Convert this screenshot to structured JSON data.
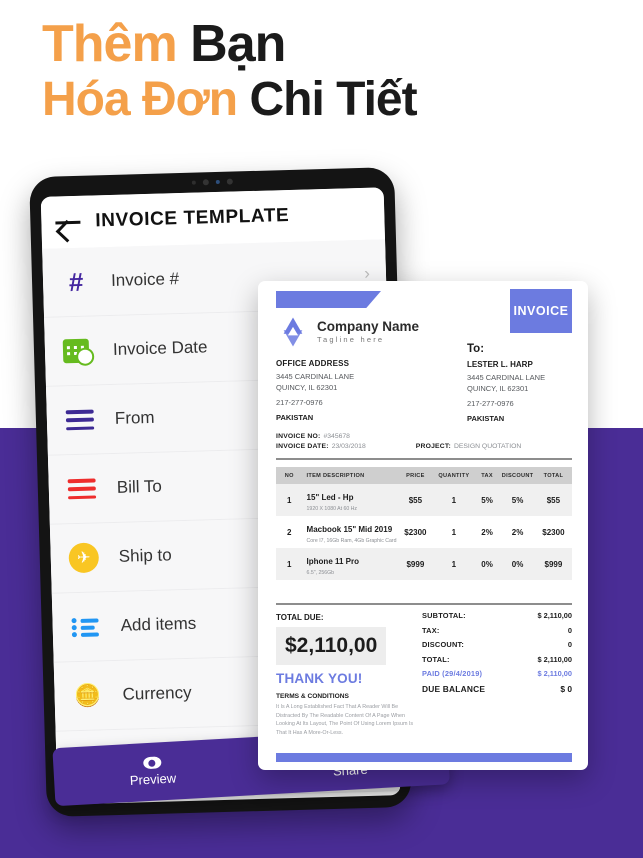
{
  "headline": {
    "line1_accent": "Thêm",
    "line1_rest": " Bạn",
    "line2_accent": "Hóa Đơn",
    "line2_rest": " Chi Tiết"
  },
  "colors": {
    "accent_orange": "#f4a04a",
    "background_purple": "#4a2d96",
    "invoice_blue": "#6c7be0",
    "tablet_black": "#141414"
  },
  "app": {
    "title": "INVOICE TEMPLATE",
    "back_icon": "back-arrow-icon",
    "menu": [
      {
        "label": "Invoice #",
        "icon": "hash-icon",
        "chevron": "›"
      },
      {
        "label": "Invoice Date",
        "icon": "calendar-clock-icon",
        "chevron": ""
      },
      {
        "label": "From",
        "icon": "purple-lines-icon",
        "chevron": ""
      },
      {
        "label": "Bill To",
        "icon": "red-lines-icon",
        "chevron": ""
      },
      {
        "label": "Ship to",
        "icon": "airplane-icon",
        "chevron": ""
      },
      {
        "label": "Add items",
        "icon": "bullet-list-icon",
        "chevron": ""
      },
      {
        "label": "Currency",
        "icon": "coins-icon",
        "chevron": ""
      }
    ],
    "actions": [
      {
        "label": "Preview",
        "icon": "eye-icon"
      },
      {
        "label": "Share",
        "icon": "send-icon"
      }
    ]
  },
  "invoice": {
    "badge": "INVOICE",
    "company_name": "Company Name",
    "tagline": "Tagline here",
    "logo_icon": "star-logo-icon",
    "office": {
      "heading": "OFFICE ADDRESS",
      "line1": "3445 CARDINAL LANE",
      "line2": "QUINCY, IL 62301",
      "phone": "217-277-0976",
      "country": "PAKISTAN"
    },
    "to": {
      "heading": "To:",
      "name": "LESTER L. HARP",
      "line1": "3445 CARDINAL LANE",
      "line2": "QUINCY, IL 62301",
      "phone": "217-277-0976",
      "country": "PAKISTAN"
    },
    "meta": {
      "invoice_no_label": "INVOICE NO:",
      "invoice_no_value": "#345678",
      "invoice_date_label": "INVOICE DATE:",
      "invoice_date_value": "23/03/2018",
      "project_label": "PROJECT:",
      "project_value": "DESIGN QUOTATION"
    },
    "table": {
      "headers": [
        "NO",
        "ITEM DESCRIPTION",
        "PRICE",
        "QUANTITY",
        "TAX",
        "DISCOUNT",
        "TOTAL"
      ],
      "rows": [
        {
          "no": "1",
          "name": "15\" Led - Hp",
          "sub": "1920 X 1080 At 60 Hz",
          "price": "$55",
          "qty": "1",
          "tax": "5%",
          "discount": "5%",
          "total": "$55"
        },
        {
          "no": "2",
          "name": "Macbook 15\" Mid 2019",
          "sub": "Core I7, 16Gb Ram, 4Gb Graphic Card",
          "price": "$2300",
          "qty": "1",
          "tax": "2%",
          "discount": "2%",
          "total": "$2300"
        },
        {
          "no": "1",
          "name": "Iphone 11 Pro",
          "sub": "6.5\", 256Gb",
          "price": "$999",
          "qty": "1",
          "tax": "0%",
          "discount": "0%",
          "total": "$999"
        }
      ]
    },
    "total_due_label": "TOTAL DUE:",
    "total_due_amount": "$2,110,00",
    "thank_you": "THANK YOU!",
    "terms_heading": "TERMS & CONDITIONS",
    "terms_body": "It Is A Long Established Fact That A Reader Will Be Distracted By The Readable Content Of A Page When Looking At Its Layout, The Point Of Using Lorem Ipsum Is That It Has A More-Or-Less.",
    "summary": [
      {
        "label": "SUBTOTAL:",
        "value": "$ 2,110,00"
      },
      {
        "label": "TAX:",
        "value": "0"
      },
      {
        "label": "DISCOUNT:",
        "value": "0"
      },
      {
        "label": "TOTAL:",
        "value": "$ 2,110,00"
      },
      {
        "label": "PAID (29/4/2019)",
        "value": "$ 2,110,00"
      },
      {
        "label": "DUE BALANCE",
        "value": "$ 0"
      }
    ]
  }
}
